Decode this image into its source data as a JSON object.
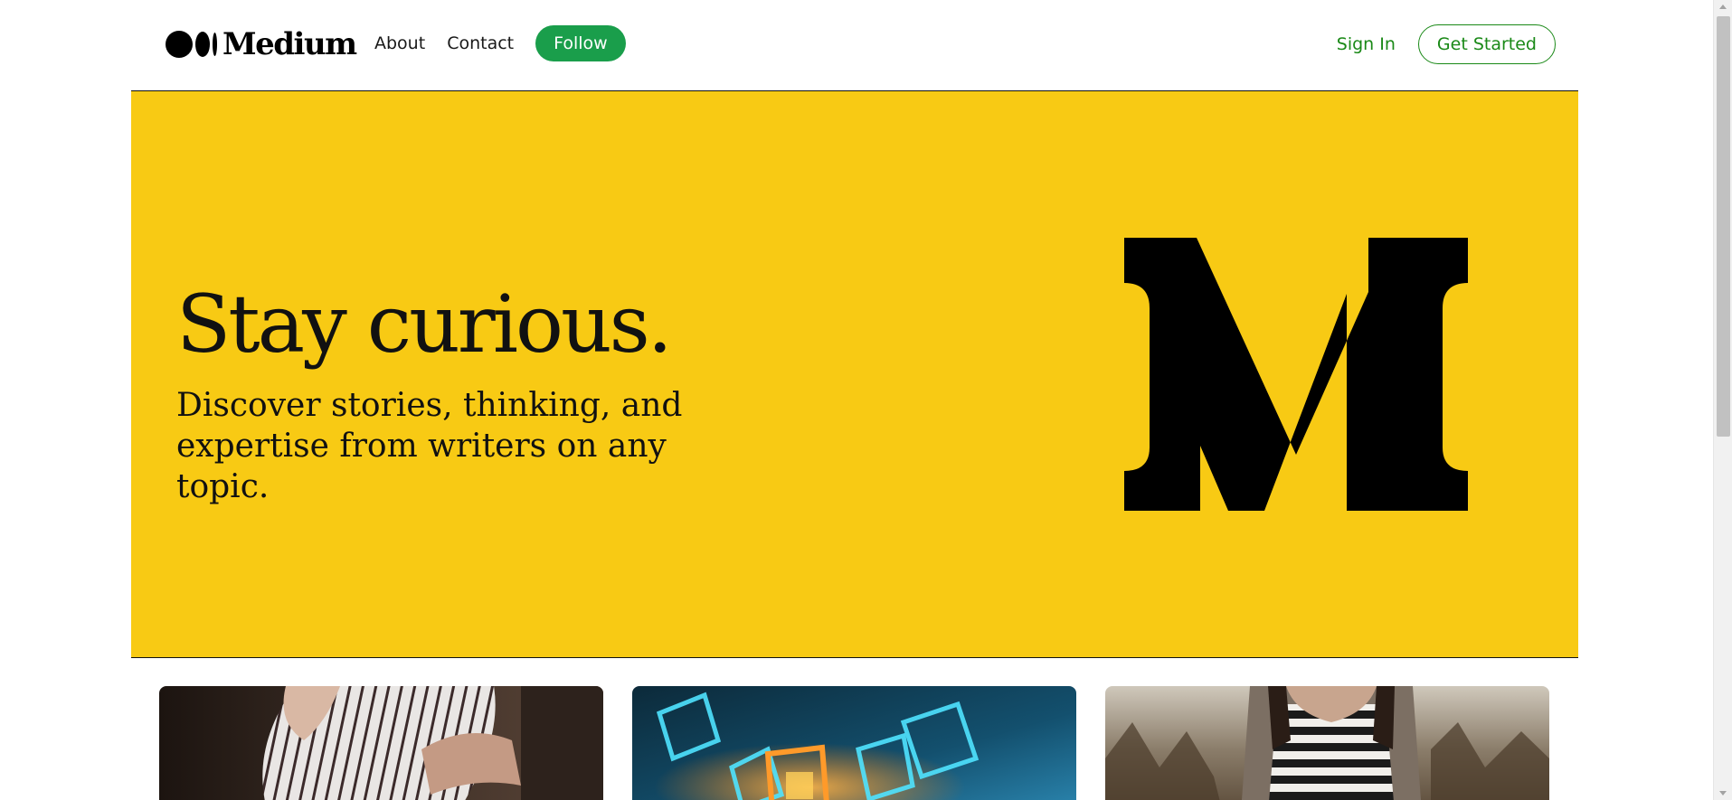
{
  "header": {
    "logo_text": "Medium",
    "logo_icon": "medium-dots-icon",
    "nav": [
      {
        "label": "About"
      },
      {
        "label": "Contact"
      }
    ],
    "follow_label": "Follow",
    "sign_in_label": "Sign In",
    "get_started_label": "Get Started"
  },
  "hero": {
    "title": "Stay curious.",
    "subtitle": "Discover stories, thinking, and expertise from writers on any topic.",
    "logo_icon": "medium-m-icon",
    "background_color": "#f8ca14"
  },
  "cards": [
    {
      "image": "person-striped-shirt-photo"
    },
    {
      "image": "glowing-cubes-photo"
    },
    {
      "image": "woman-striped-top-photo"
    }
  ],
  "colors": {
    "accent_green": "#1a8917",
    "follow_green": "#1a9e4b",
    "hero_yellow": "#f8ca14"
  }
}
